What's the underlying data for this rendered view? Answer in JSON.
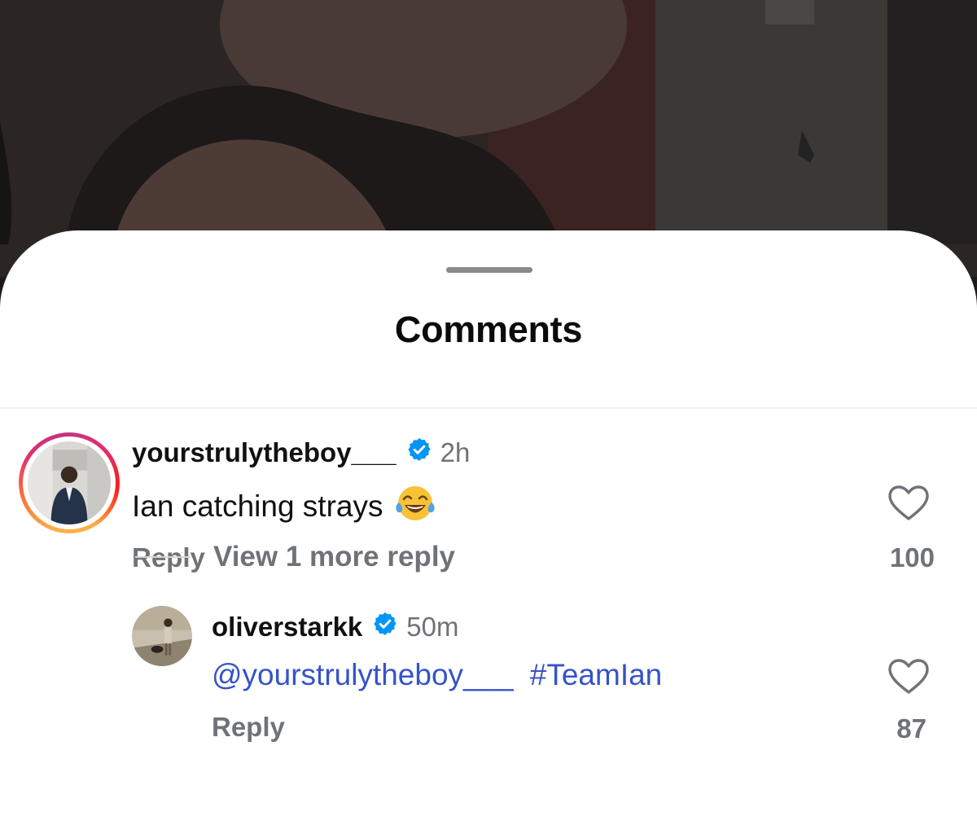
{
  "sheet": {
    "title": "Comments"
  },
  "comments": [
    {
      "username": "yourstrulytheboy___",
      "verified": true,
      "time": "2h",
      "text": "Ian catching strays",
      "emoji": "face-with-tears-of-joy",
      "reply_label": "Reply",
      "like_count": "100",
      "avatar_has_story_ring": true
    }
  ],
  "replies": [
    {
      "username": "oliverstarkk",
      "verified": true,
      "time": "50m",
      "mention": "@yourstrulytheboy___",
      "hashtag": "#TeamIan",
      "reply_label": "Reply",
      "like_count": "87"
    }
  ],
  "view_more_replies_label": "View 1 more reply",
  "colors": {
    "verified_badge": "#0095f6",
    "link_blue": "#3753c8",
    "secondary_text": "#6f7378"
  },
  "icons": [
    "verified-badge-icon",
    "heart-outline-icon",
    "laughing-emoji-icon"
  ]
}
